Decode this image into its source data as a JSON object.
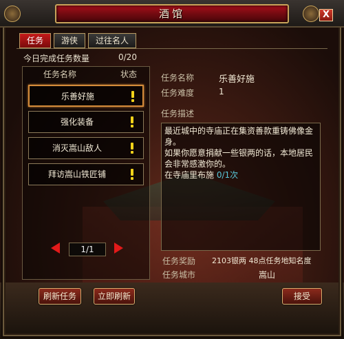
{
  "window": {
    "title": "酒馆",
    "close_label": "X"
  },
  "tabs": [
    {
      "label": "任务",
      "active": true
    },
    {
      "label": "游侠",
      "active": false
    },
    {
      "label": "过往名人",
      "active": false
    }
  ],
  "daily": {
    "label": "今日完成任务数量",
    "value": "0/20"
  },
  "list": {
    "header_name": "任务名称",
    "header_status": "状态",
    "items": [
      {
        "name": "乐善好施",
        "status": "!",
        "selected": true
      },
      {
        "name": "强化装备",
        "status": "!"
      },
      {
        "name": "消灭嵩山敌人",
        "status": "!"
      },
      {
        "name": "拜访嵩山铁匠铺",
        "status": "!"
      }
    ],
    "page": "1/1"
  },
  "detail": {
    "name_label": "任务名称",
    "name_value": "乐善好施",
    "difficulty_label": "任务难度",
    "difficulty_value": "1",
    "desc_label": "任务描述",
    "desc_line1": "最近城中的寺庙正在集资善款重铸佛像金身。",
    "desc_line2": "如果你愿意捐献一些银两的话，本地居民会非常感激你的。",
    "desc_line3_prefix": "在寺庙里布施 ",
    "desc_line3_count": "0/1次",
    "reward_label": "任务奖励",
    "reward_value": "2103银两 48点任务地知名度",
    "city_label": "任务城市",
    "city_value": "嵩山"
  },
  "buttons": {
    "refresh": "刷新任务",
    "refresh_now": "立即刷新",
    "accept": "接受"
  },
  "colors": {
    "accent_red": "#c41a1a",
    "gold_border": "#c9a45a",
    "status_yellow": "#f2d21a"
  },
  "icons": {
    "close": "close-icon",
    "status": "exclamation-icon",
    "prev": "arrow-left-icon",
    "next": "arrow-right-icon"
  }
}
